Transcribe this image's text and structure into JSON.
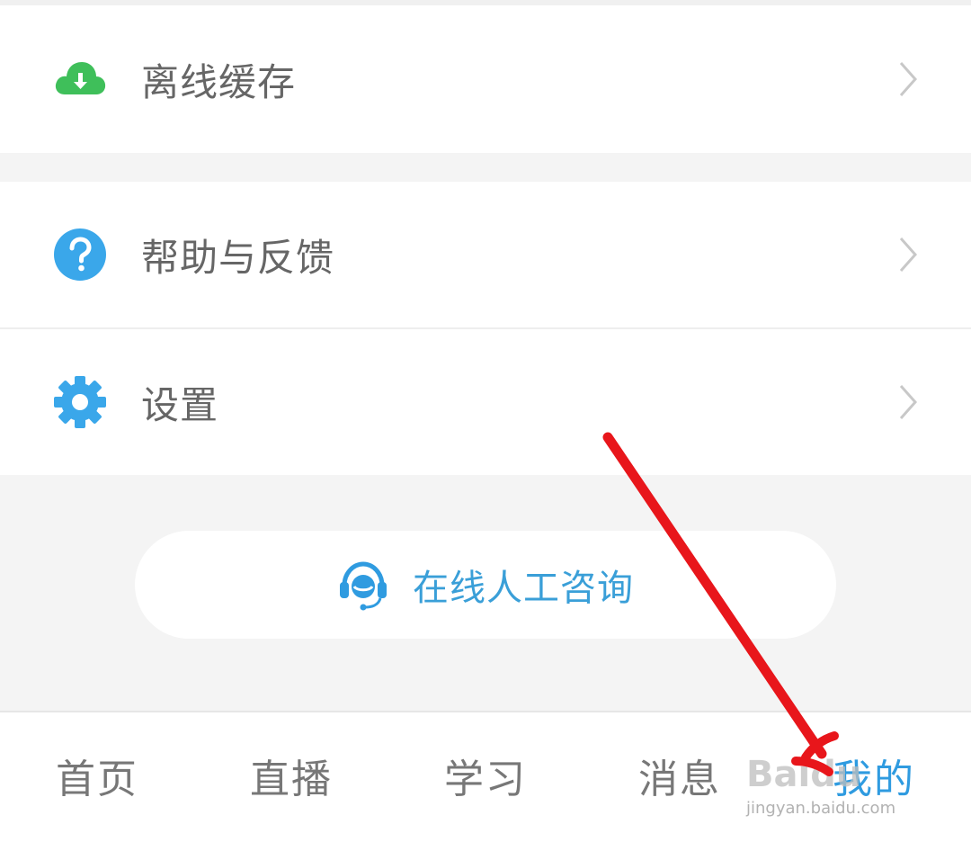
{
  "menu": {
    "offline_cache": "离线缓存",
    "help_feedback": "帮助与反馈",
    "settings": "设置"
  },
  "consult_button": {
    "label": "在线人工咨询"
  },
  "tabbar": {
    "tabs": [
      "首页",
      "直播",
      "学习",
      "消息",
      "我的"
    ],
    "active_index": 4
  },
  "watermark": {
    "brand": "Baidu",
    "url": "jingyan.baidu.com"
  },
  "colors": {
    "accent": "#2f9be0",
    "cloud_green": "#3fbf5a",
    "help_blue": "#3aa7ea",
    "arrow_red": "#e8161b"
  },
  "icons": [
    "cloud-download-icon",
    "question-icon",
    "gear-icon",
    "headset-icon",
    "chevron-right-icon"
  ]
}
